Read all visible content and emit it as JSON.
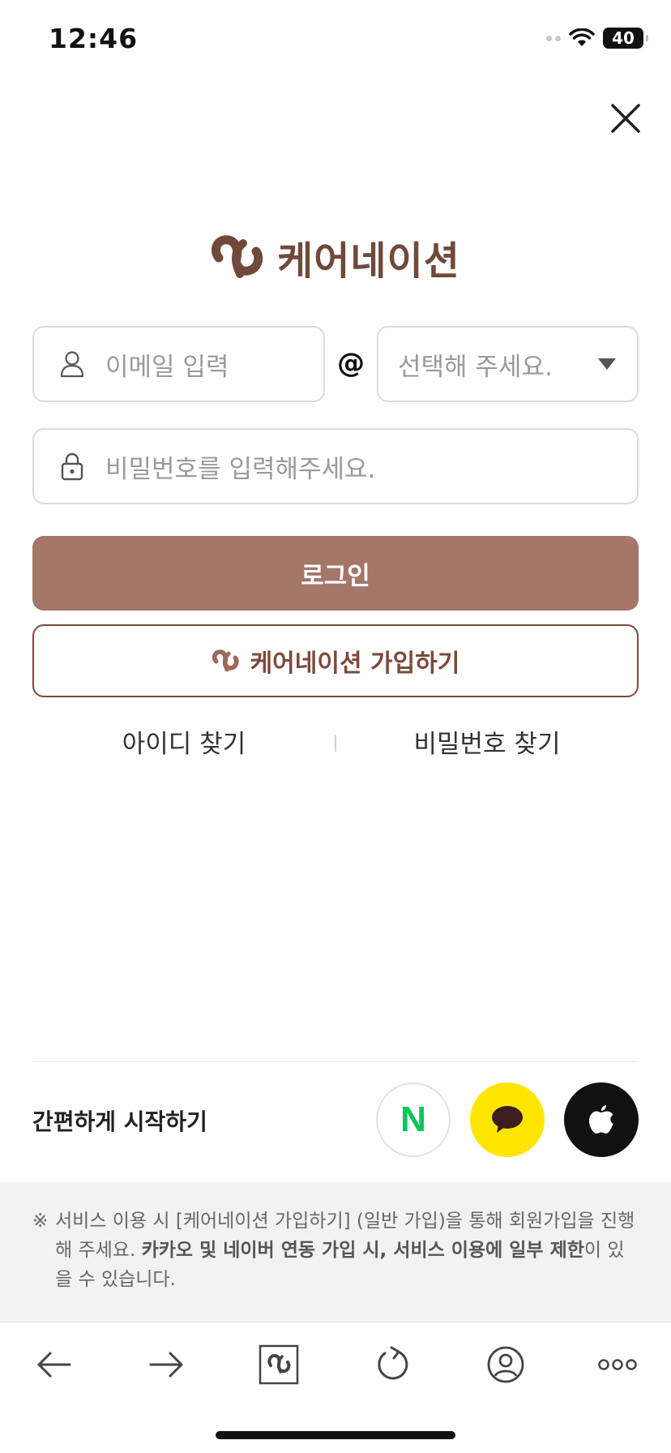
{
  "status_bar": {
    "time": "12:46",
    "battery": "40"
  },
  "brand": {
    "name": "케어네이션"
  },
  "login_form": {
    "email_placeholder": "이메일 입력",
    "at_sign": "@",
    "domain_placeholder": "선택해 주세요.",
    "password_placeholder": "비밀번호를 입력해주세요.",
    "login_label": "로그인",
    "signup_label": "케어네이션 가입하기"
  },
  "find_links": {
    "find_id": "아이디 찾기",
    "find_password": "비밀번호 찾기"
  },
  "social": {
    "title": "간편하게 시작하기",
    "naver_letter": "N"
  },
  "notice": {
    "mark": "※",
    "text_1": "서비스 이용 시 [케어네이션 가입하기] (일반 가입)을 통해 회원가입을 진행해 주세요. ",
    "text_bold": "카카오 및 네이버 연동 가입 시, 서비스 이용에 일부 제한",
    "text_2": "이 있을 수 있습니다."
  },
  "colors": {
    "brand_brown": "#6f4a3a",
    "login_button": "#a47768",
    "kakao_yellow": "#fee500",
    "naver_green": "#03c75a",
    "apple_black": "#111111"
  },
  "icons": {
    "close": "close-icon",
    "user": "user-icon",
    "lock": "lock-icon",
    "back": "back-arrow-icon",
    "forward": "forward-arrow-icon",
    "home": "carenation-logo-icon",
    "refresh": "refresh-icon",
    "profile": "profile-icon",
    "more": "more-icon"
  }
}
